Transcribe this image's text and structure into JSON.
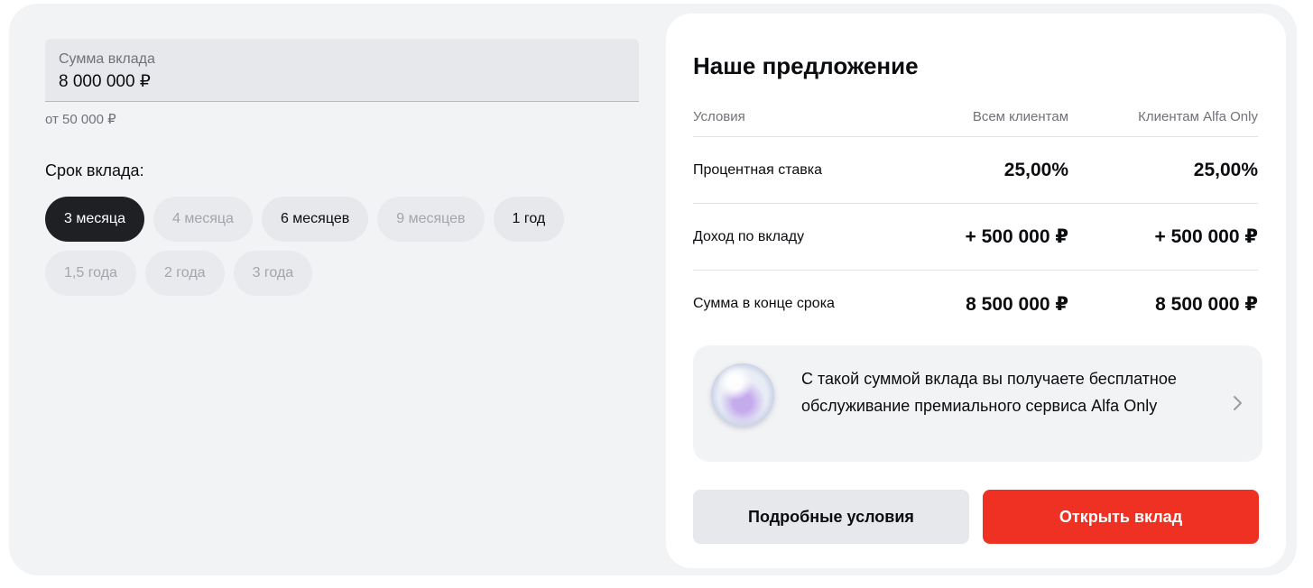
{
  "deposit": {
    "amount_label": "Сумма вклада",
    "amount_value": "8 000 000 ₽",
    "amount_hint": "от 50 000 ₽",
    "term_label": "Срок вклада:",
    "terms": [
      {
        "label": "3 месяца",
        "state": "selected"
      },
      {
        "label": "4 месяца",
        "state": "disabled"
      },
      {
        "label": "6 месяцев",
        "state": "available"
      },
      {
        "label": "9 месяцев",
        "state": "disabled"
      },
      {
        "label": "1 год",
        "state": "available"
      },
      {
        "label": "1,5 года",
        "state": "disabled"
      },
      {
        "label": "2 года",
        "state": "disabled"
      },
      {
        "label": "3 года",
        "state": "disabled"
      }
    ]
  },
  "offer": {
    "title": "Наше предложение",
    "columns": [
      "Условия",
      "Всем клиентам",
      "Клиентам Alfa Only"
    ],
    "rows": [
      {
        "name": "Процентная ставка",
        "all": "25,00%",
        "alfa_only": "25,00%"
      },
      {
        "name": "Доход по вкладу",
        "all": "+ 500 000 ₽",
        "alfa_only": "+ 500 000 ₽"
      },
      {
        "name": "Сумма в конце срока",
        "all": "8 500 000 ₽",
        "alfa_only": "8 500 000 ₽"
      }
    ],
    "promo_text": "С такой суммой вклада вы получаете бесплатное обслуживание премиального сервиса Alfa Only",
    "details_button": "Подробные условия",
    "open_button": "Открыть вклад"
  },
  "colors": {
    "accent": "#ef3124",
    "selected_chip": "#1f2023",
    "background": "#f2f3f5"
  },
  "icons": {
    "promo": "alfa-only-orb-icon",
    "promo_arrow": "chevron-right-icon"
  }
}
